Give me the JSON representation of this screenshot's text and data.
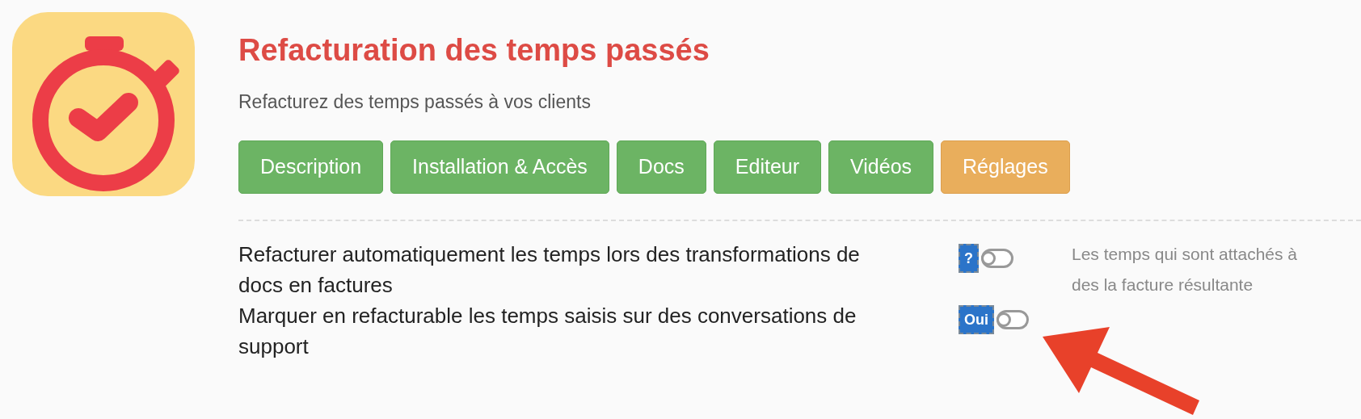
{
  "app": {
    "title": "Refacturation des temps passés",
    "subtitle": "Refacturez des temps passés à vos clients"
  },
  "tabs": [
    {
      "label": "Description",
      "selected": false
    },
    {
      "label": "Installation & Accès",
      "selected": false
    },
    {
      "label": "Docs",
      "selected": false
    },
    {
      "label": "Editeur",
      "selected": false
    },
    {
      "label": "Vidéos",
      "selected": false
    },
    {
      "label": "Réglages",
      "selected": true
    }
  ],
  "settings": [
    {
      "label": "Refacturer automatiquement les temps lors des transformations de docs en factures",
      "badge": "?",
      "on": false,
      "help": "Les temps qui sont attachés à des la facture résultante"
    },
    {
      "label": "Marquer en refacturable les temps saisis sur des conversations de support",
      "badge": "Oui",
      "on": false
    }
  ],
  "annotation": {
    "kind": "arrow"
  }
}
